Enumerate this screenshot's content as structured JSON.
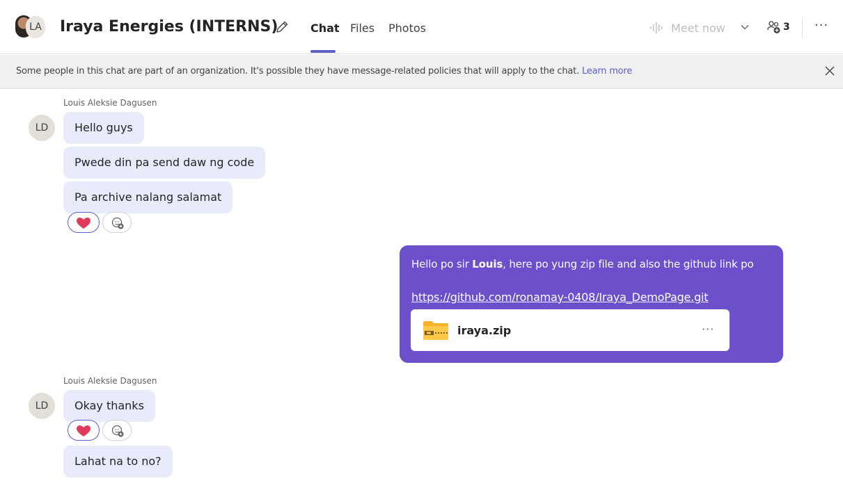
{
  "header": {
    "avatar_initials": "LA",
    "title": "Iraya Energies (INTERNS)",
    "tabs": [
      {
        "label": "Chat",
        "active": true
      },
      {
        "label": "Files",
        "active": false
      },
      {
        "label": "Photos",
        "active": false
      }
    ],
    "meet_now_label": "Meet now",
    "participant_count": "3",
    "more_label": "···"
  },
  "banner": {
    "text": "Some people in this chat are part of an organization. It's possible they have message-related policies that will apply to the chat.",
    "link": "Learn more"
  },
  "messages": {
    "group1": {
      "sender": "Louis Aleksie Dagusen",
      "avatar": "LD",
      "bubbles": [
        "Hello guys",
        "Pwede din pa send daw ng code",
        "Pa archive nalang salamat"
      ]
    },
    "own": {
      "text_before": "Hello po sir ",
      "text_bold": "Louis",
      "text_after": ", here po yung zip file and also the github link po",
      "link": "https://github.com/ronamay-0408/Iraya_DemoPage.git",
      "attachment_name": "iraya.zip",
      "attachment_more": "···"
    },
    "group2": {
      "sender": "Louis Aleksie Dagusen",
      "avatar": "LD",
      "bubbles": [
        "Okay thanks",
        "Lahat na to no?"
      ]
    }
  },
  "colors": {
    "accent": "#5b5fc7",
    "own_bubble": "#6b4fcb",
    "incoming_bubble": "#e8ebfa",
    "heart": "#e03a5c"
  }
}
